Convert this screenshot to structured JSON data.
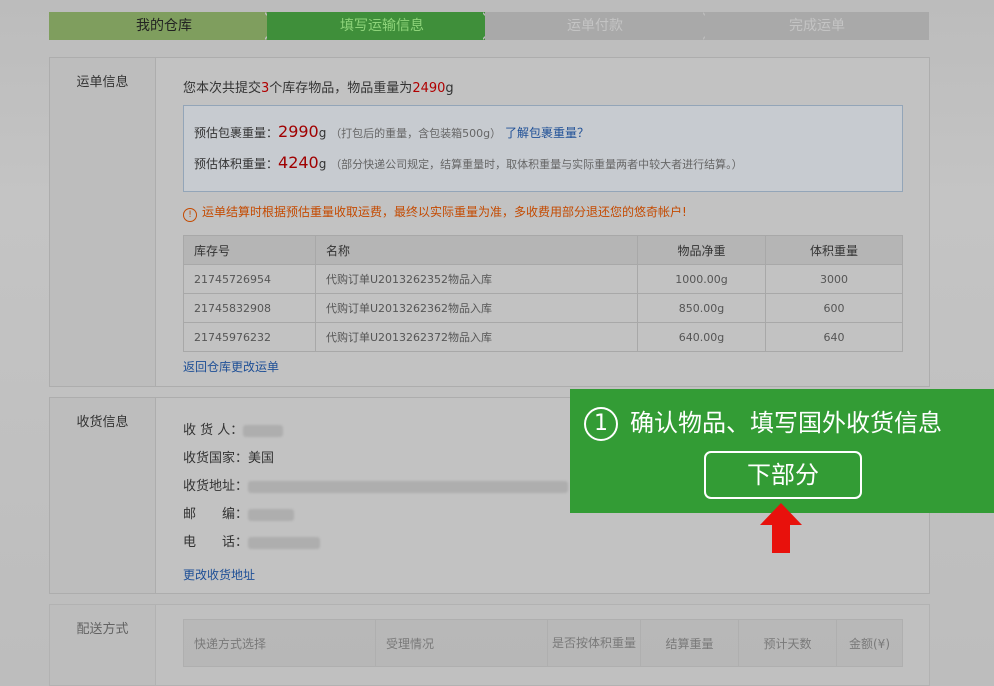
{
  "steps": [
    {
      "label": "我的仓库"
    },
    {
      "label": "填写运输信息"
    },
    {
      "label": "运单付款"
    },
    {
      "label": "完成运单"
    }
  ],
  "waybill": {
    "section_title": "运单信息",
    "summary_prefix": "您本次共提交",
    "item_count": "3",
    "summary_middle": "个库存物品，物品重量为",
    "item_weight": "2490",
    "summary_unit": "g",
    "est_pkg_label": "预估包裹重量：",
    "est_pkg_value": "2990",
    "est_unit": "g",
    "est_pkg_note": "（打包后的重量，含包装箱500g）",
    "learn_link": "了解包裹重量？",
    "est_vol_label": "预估体积重量：",
    "est_vol_value": "4240",
    "est_vol_note": "（部分快递公司规定，结算重量时，取体积重量与实际重量两者中较大者进行结算。）",
    "warning": "运单结算时根据预估重量收取运费，最终以实际重量为准，多收费用部分退还您的悠奇帐户!",
    "table": {
      "headers": [
        "库存号",
        "名称",
        "物品净重",
        "体积重量"
      ],
      "rows": [
        [
          "21745726954",
          "代购订单U2013262352物品入库",
          "1000.00g",
          "3000"
        ],
        [
          "21745832908",
          "代购订单U2013262362物品入库",
          "850.00g",
          "600"
        ],
        [
          "21745976232",
          "代购订单U2013262372物品入库",
          "640.00g",
          "640"
        ]
      ]
    },
    "back_link": "返回仓库更改运单"
  },
  "receiver": {
    "section_title": "收货信息",
    "name_label": "收 货 人：",
    "country_label": "收货国家：",
    "country_value": "美国",
    "address_label": "收货地址：",
    "zip_label": "邮　　编：",
    "phone_label": "电　　话：",
    "edit_link": "更改收货地址"
  },
  "shipping": {
    "section_title": "配送方式",
    "headers": [
      "快递方式选择",
      "受理情况",
      "是否按体积重量",
      "结算重量",
      "预计天数",
      "金额(¥)"
    ]
  },
  "callout": {
    "number": "1",
    "title": "确认物品、填写国外收货信息",
    "button": "下部分"
  },
  "colors": {
    "callout_bg": "#339c35",
    "highlight": "#b00000",
    "link": "#1e4f96",
    "warning": "#c44a00",
    "arrow": "#e8110c"
  }
}
